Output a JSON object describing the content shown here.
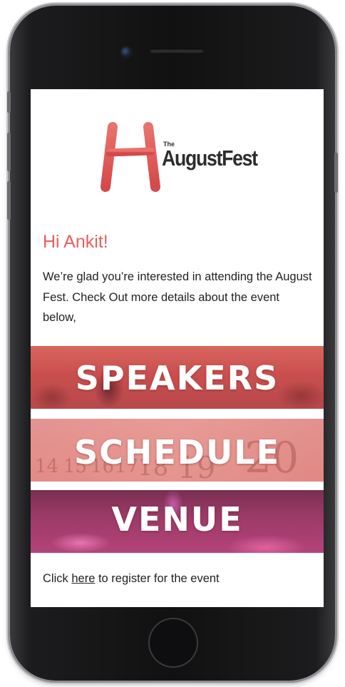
{
  "logo": {
    "small_text": "The",
    "wordmark": "AugustFest"
  },
  "greeting": "Hi Ankit!",
  "intro": "We’re glad you’re interested in attending the August Fest. Check Out more  details about the event below,",
  "banners": [
    {
      "label": "SPEAKERS"
    },
    {
      "label": "SCHEDULE"
    },
    {
      "label": "VENUE"
    }
  ],
  "register": {
    "prefix": "Click ",
    "link": "here",
    "suffix": " to register for the event"
  },
  "colors": {
    "accent": "#e4615d",
    "text": "#222222"
  }
}
